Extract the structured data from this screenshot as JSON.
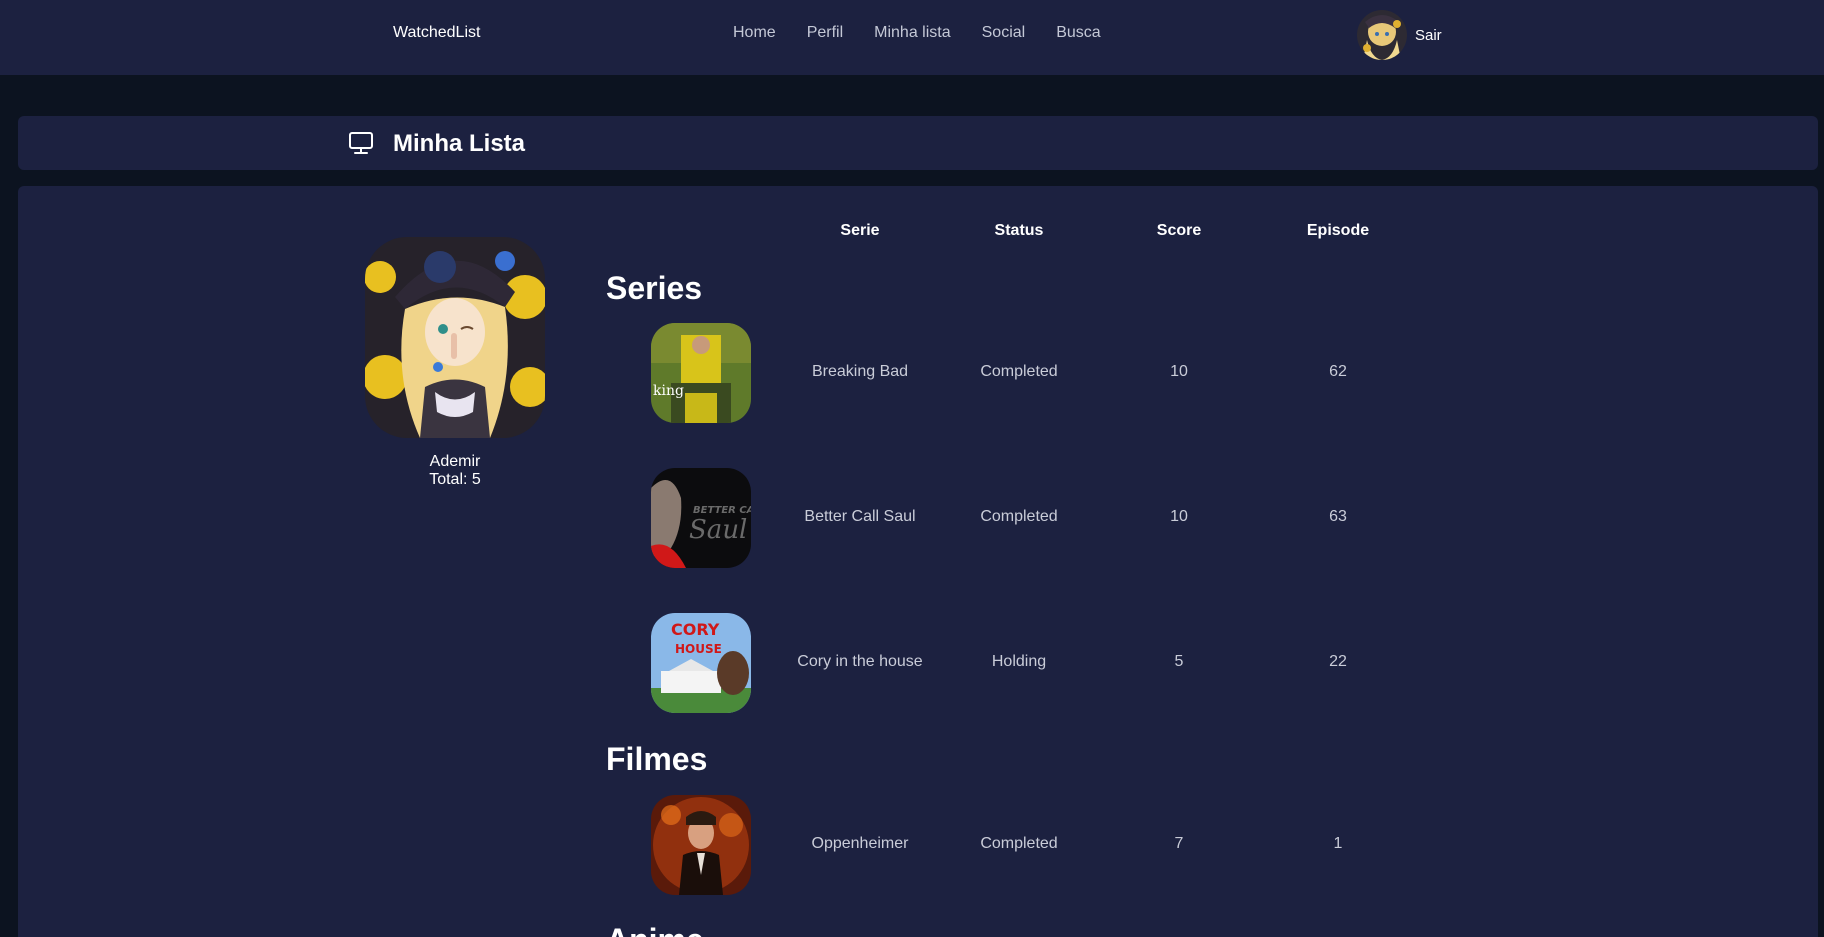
{
  "navbar": {
    "brand": "WatchedList",
    "links": [
      "Home",
      "Perfil",
      "Minha lista",
      "Social",
      "Busca"
    ],
    "logout": "Sair"
  },
  "page": {
    "title": "Minha Lista"
  },
  "profile": {
    "name": "Ademir",
    "total": "Total: 5"
  },
  "table": {
    "headers": [
      "Serie",
      "Status",
      "Score",
      "Episode"
    ]
  },
  "sections": [
    {
      "title": "Series",
      "rows": [
        {
          "name": "Breaking Bad",
          "status": "Completed",
          "score": "10",
          "episode": "62"
        },
        {
          "name": "Better Call Saul",
          "status": "Completed",
          "score": "10",
          "episode": "63"
        },
        {
          "name": "Cory in the house",
          "status": "Holding",
          "score": "5",
          "episode": "22"
        }
      ]
    },
    {
      "title": "Filmes",
      "rows": [
        {
          "name": "Oppenheimer",
          "status": "Completed",
          "score": "7",
          "episode": "1"
        }
      ]
    },
    {
      "title": "Anime",
      "rows": []
    }
  ],
  "poster_text": {
    "bb": "king",
    "bcs_top": "BETTER CALL",
    "bcs_bottom": "Saul",
    "cory_title": "CORY",
    "cory_sub": "HOUSE"
  },
  "colors": {
    "background": "#0c1320",
    "panel": "#1c2140",
    "text": "#ffffff",
    "muted_text": "#c9ccd8"
  }
}
